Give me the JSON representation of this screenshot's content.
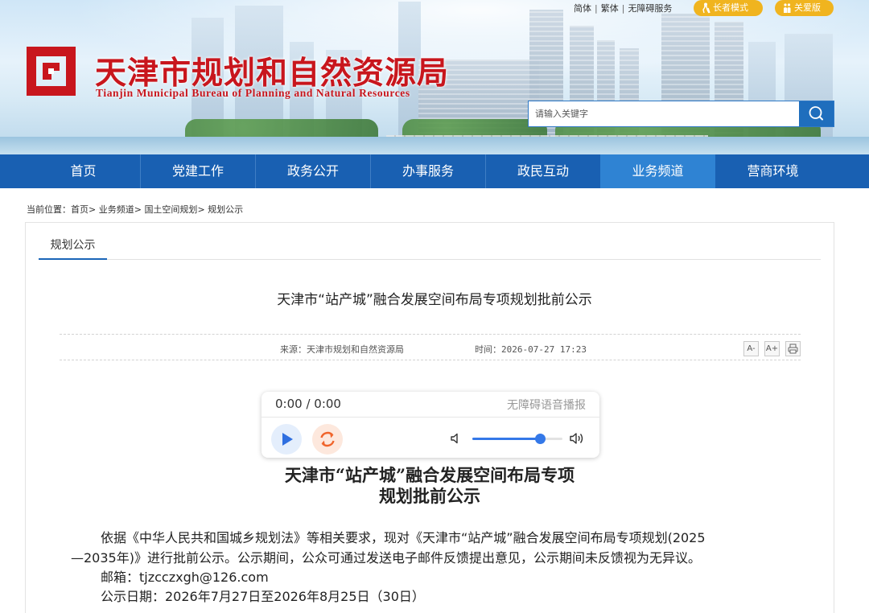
{
  "header": {
    "top_links": [
      "简体",
      "繁体",
      "无障碍服务"
    ],
    "elder_mode": "长者模式",
    "care_version": "关爱版",
    "site_title_cn": "天津市规划和自然资源局",
    "site_title_en": "Tianjin Municipal Bureau of Planning and Natural Resources",
    "search_placeholder": "请输入关键字",
    "brand_color": "#c8161d"
  },
  "nav": {
    "items": [
      "首页",
      "党建工作",
      "政务公开",
      "办事服务",
      "政民互动",
      "业务频道",
      "营商环境"
    ],
    "active": "业务频道",
    "color": "#1960b2"
  },
  "breadcrumb": {
    "label": "当前位置：",
    "items": [
      "首页",
      "业务频道",
      "国土空间规划",
      "规划公示"
    ],
    "separator": ">"
  },
  "content": {
    "tab": "规划公示",
    "article_title": "天津市“站产城”融合发展空间布局专项规划批前公示",
    "source": "来源：天津市规划和自然资源局",
    "time": "时间：2026-07-27 17:23",
    "tools": [
      "A-",
      "A+",
      "print-icon"
    ]
  },
  "player": {
    "time": "0:00 / 0:00",
    "label": "无障碍语音播报",
    "volume": 0.75
  },
  "body": {
    "title_line1": "天津市“站产城”融合发展空间布局专项",
    "title_line2": "规划批前公示",
    "para1_line1": "依据《中华人民共和国城乡规划法》等相关要求，现对《天津市“站产城”融合发展空间布局专项规划(2025",
    "para1_line2": "—2035年)》进行批前公示。公示期间，公众可通过发送电子邮件反馈提出意见，公示期间未反馈视为无异议。",
    "email": "邮箱：tjzcczxgh@126.com",
    "period": "公示日期：2026年7月27日至2026年8月25日（30日）"
  }
}
